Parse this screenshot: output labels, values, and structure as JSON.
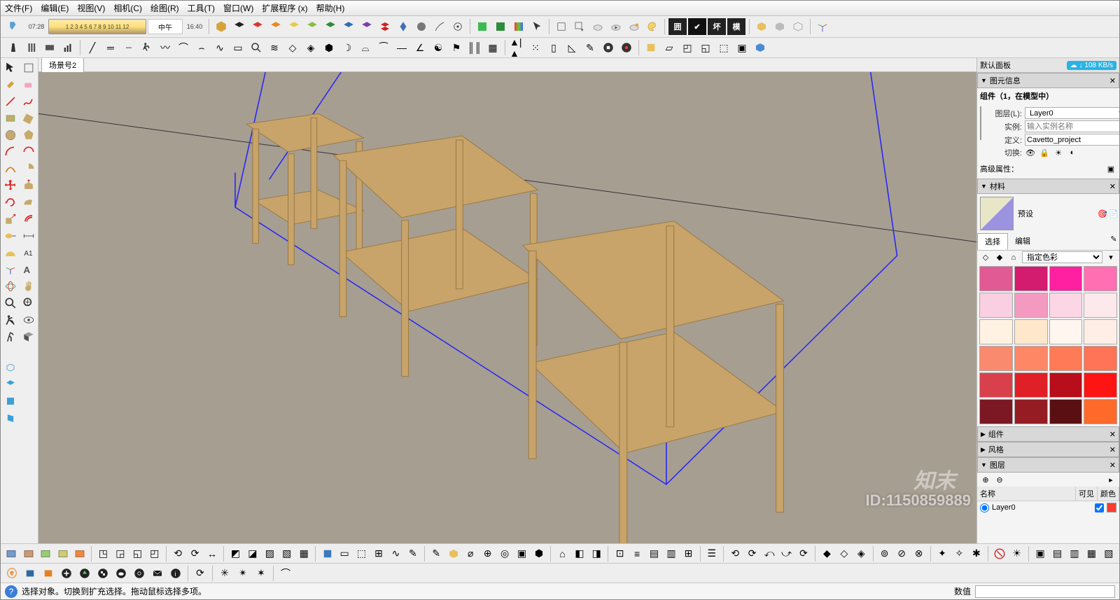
{
  "menu": {
    "file": "文件(F)",
    "edit": "编辑(E)",
    "view": "视图(V)",
    "camera": "相机(C)",
    "draw": "绘图(R)",
    "tools": "工具(T)",
    "window": "窗口(W)",
    "extensions": "扩展程序 (x)",
    "help": "帮助(H)"
  },
  "toolbar1": {
    "time_start": "07:28",
    "ruler_marks": "1 2 3 4 5 6 7 8 9 10 11 12",
    "day_label": "中午",
    "time_end": "16:40",
    "badge1": "囲",
    "badge2": "✔",
    "badge3": "坏",
    "badge4": "模"
  },
  "scene_tab": "场景号2",
  "right": {
    "default_panel": "默认面板",
    "speed": "↓ 108 KB/s",
    "entity_info_hdr": "图元信息",
    "component_title": "组件（1，在模型中）",
    "layer_label": "图层(L):",
    "layer_value": "Layer0",
    "instance_label": "实例:",
    "instance_placeholder": "输入实例名称",
    "definition_label": "定义:",
    "definition_value": "Cavetto_project",
    "toggle_label": "切换:",
    "advanced_label": "高级属性：",
    "materials_hdr": "材料",
    "preset_label": "预设",
    "select_tab": "选择",
    "edit_tab": "编辑",
    "color_mode": "指定色彩",
    "components_hdr": "组件",
    "styles_hdr": "风格",
    "layers_hdr": "图层",
    "col_name": "名称",
    "col_visible": "可见",
    "col_color": "颜色",
    "layer0": "Layer0"
  },
  "status": {
    "hint": "选择对象。切换到扩充选择。拖动鼠标选择多项。",
    "measure_label": "数值"
  },
  "id_mark": "ID:1150859889",
  "brand": "知末",
  "swatches": [
    "#e15a93",
    "#d31b6f",
    "#ff1fa1",
    "#ff6fb2",
    "#facfe1",
    "#f49ac1",
    "#fdd6e6",
    "#fde9ec",
    "#fff2e3",
    "#ffe7cb",
    "#fef6ef",
    "#ffeee6",
    "#f98a6d",
    "#fe8866",
    "#ff7b57",
    "#ff7356",
    "#d8414c",
    "#e01f27",
    "#b80d1a",
    "#ff1414",
    "#7c1824",
    "#961c24",
    "#5a1013",
    "#ff6a2a"
  ]
}
